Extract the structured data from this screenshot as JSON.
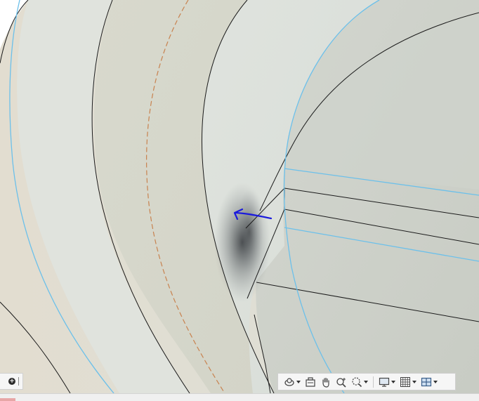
{
  "app": {
    "view": "3d-viewport"
  },
  "viewport": {
    "colors": {
      "background_left": "#ddddd3",
      "surface_light": "#dfe3dd",
      "surface_mid": "#d9dbd1",
      "surface_inner": "#cfd2ca",
      "edge": "#1a1a1a",
      "highlight_edge": "#6cc0ea",
      "dashed_edge": "#c8824f",
      "annotation": "#1a1adc"
    }
  },
  "mini_toolbar": {
    "icons": [
      "add-icon"
    ]
  },
  "nav_bar": {
    "tools": [
      {
        "name": "orbit",
        "icon": "orbit-icon",
        "has_menu": true
      },
      {
        "name": "look-at",
        "icon": "look-at-icon",
        "has_menu": false
      },
      {
        "name": "pan",
        "icon": "pan-hand-icon",
        "has_menu": false
      },
      {
        "name": "zoom",
        "icon": "zoom-icon",
        "has_menu": false
      },
      {
        "name": "zoom-window",
        "icon": "zoom-window-icon",
        "has_menu": true
      },
      {
        "name": "display-settings",
        "icon": "monitor-icon",
        "has_menu": true
      },
      {
        "name": "grid-snap",
        "icon": "grid-icon",
        "has_menu": true
      },
      {
        "name": "viewports",
        "icon": "viewports-icon",
        "has_menu": true
      }
    ]
  }
}
